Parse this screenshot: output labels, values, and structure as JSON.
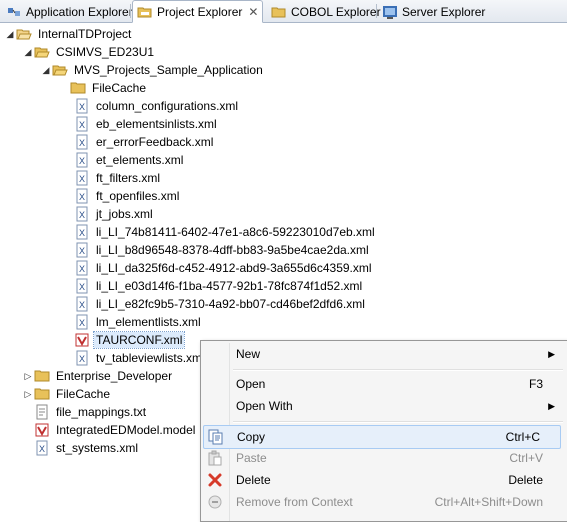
{
  "tabs": [
    {
      "label": "Application Explorer",
      "icon": "app-explorer-icon",
      "active": false
    },
    {
      "label": "Project Explorer",
      "icon": "project-explorer-icon",
      "active": true
    },
    {
      "label": "COBOL Explorer",
      "icon": "cobol-explorer-icon",
      "active": false
    },
    {
      "label": "Server Explorer",
      "icon": "server-explorer-icon",
      "active": false
    }
  ],
  "tree": {
    "root": "InternalTDProject",
    "connection": "CSIMVS_ED23U1",
    "project": "MVS_Projects_Sample_Application",
    "files": [
      "FileCache",
      "column_configurations.xml",
      "eb_elementsinlists.xml",
      "er_errorFeedback.xml",
      "et_elements.xml",
      "ft_filters.xml",
      "ft_openfiles.xml",
      "jt_jobs.xml",
      "li_LI_74b81411-6402-47e1-a8c6-59223010d7eb.xml",
      "li_LI_b8d96548-8378-4dff-bb83-9a5be4cae2da.xml",
      "li_LI_da325f6d-c452-4912-abd9-3a655d6c4359.xml",
      "li_LI_e03d14f6-f1ba-4577-92b1-78fc874f1d52.xml",
      "li_LI_e82fc9b5-7310-4a92-bb07-cd46bef2dfd6.xml",
      "lm_elementlists.xml",
      "TAURCONF.xml",
      "tv_tableviewlists.xm"
    ],
    "top_level": [
      "Enterprise_Developer",
      "FileCache",
      "file_mappings.txt",
      "IntegratedEDModel.model",
      "st_systems.xml"
    ]
  },
  "context_menu": {
    "items": [
      {
        "label": "New",
        "accel": "",
        "submenu": true,
        "icon": "",
        "disabled": false
      },
      {
        "label": "Open",
        "accel": "F3",
        "submenu": false,
        "icon": "",
        "disabled": false
      },
      {
        "label": "Open With",
        "accel": "",
        "submenu": true,
        "icon": "",
        "disabled": false
      },
      {
        "label": "Copy",
        "accel": "Ctrl+C",
        "submenu": false,
        "icon": "copy-icon",
        "disabled": false,
        "highlighted": true
      },
      {
        "label": "Paste",
        "accel": "Ctrl+V",
        "submenu": false,
        "icon": "paste-icon",
        "disabled": true
      },
      {
        "label": "Delete",
        "accel": "Delete",
        "submenu": false,
        "icon": "delete-icon",
        "disabled": false
      },
      {
        "label": "Remove from Context",
        "accel": "Ctrl+Alt+Shift+Down",
        "submenu": false,
        "icon": "remove-context-icon",
        "disabled": true
      }
    ]
  },
  "colors": {
    "selection": "#dcebfc",
    "menu_highlight": "#e6effa",
    "folder": "#e8c15a"
  }
}
